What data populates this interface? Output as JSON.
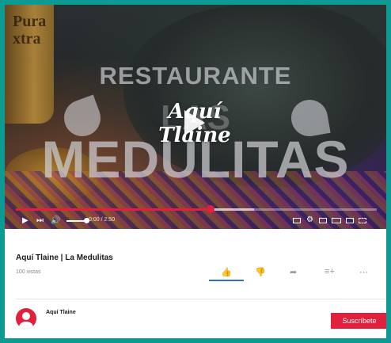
{
  "video": {
    "overlay_title_top": "RESTAURANTE",
    "overlay_title_middle": "LAS",
    "overlay_title_bottom": "MEDULITAS",
    "overlay_script": "Aquí Tlaine",
    "bottle_label": "Pura\nxtra",
    "time_display": "0:00 / 2:50",
    "progress_played_fraction": 0.54,
    "progress_buffered_fraction": 0.66,
    "accent_color": "#e0203c",
    "icons": [
      "play-icon",
      "skip-next-icon",
      "volume-icon",
      "subtitles-icon",
      "settings-icon",
      "miniplayer-icon",
      "theater-icon",
      "cast-icon",
      "fullscreen-icon"
    ]
  },
  "info": {
    "title": "Aquí Tlaine | La Medulitas",
    "views": "100 vistas",
    "actions": {
      "like_icon": "thumbs-up-icon",
      "dislike_icon": "thumbs-down-icon",
      "share_icon": "share-icon",
      "save_icon": "add-to-playlist-icon",
      "more_icon": "more-icon"
    },
    "like_color": "#2f6fd1"
  },
  "channel": {
    "name": "Aquí Tlaine",
    "subscribe_label": "Suscríbete",
    "avatar_color": "#e0203c"
  }
}
